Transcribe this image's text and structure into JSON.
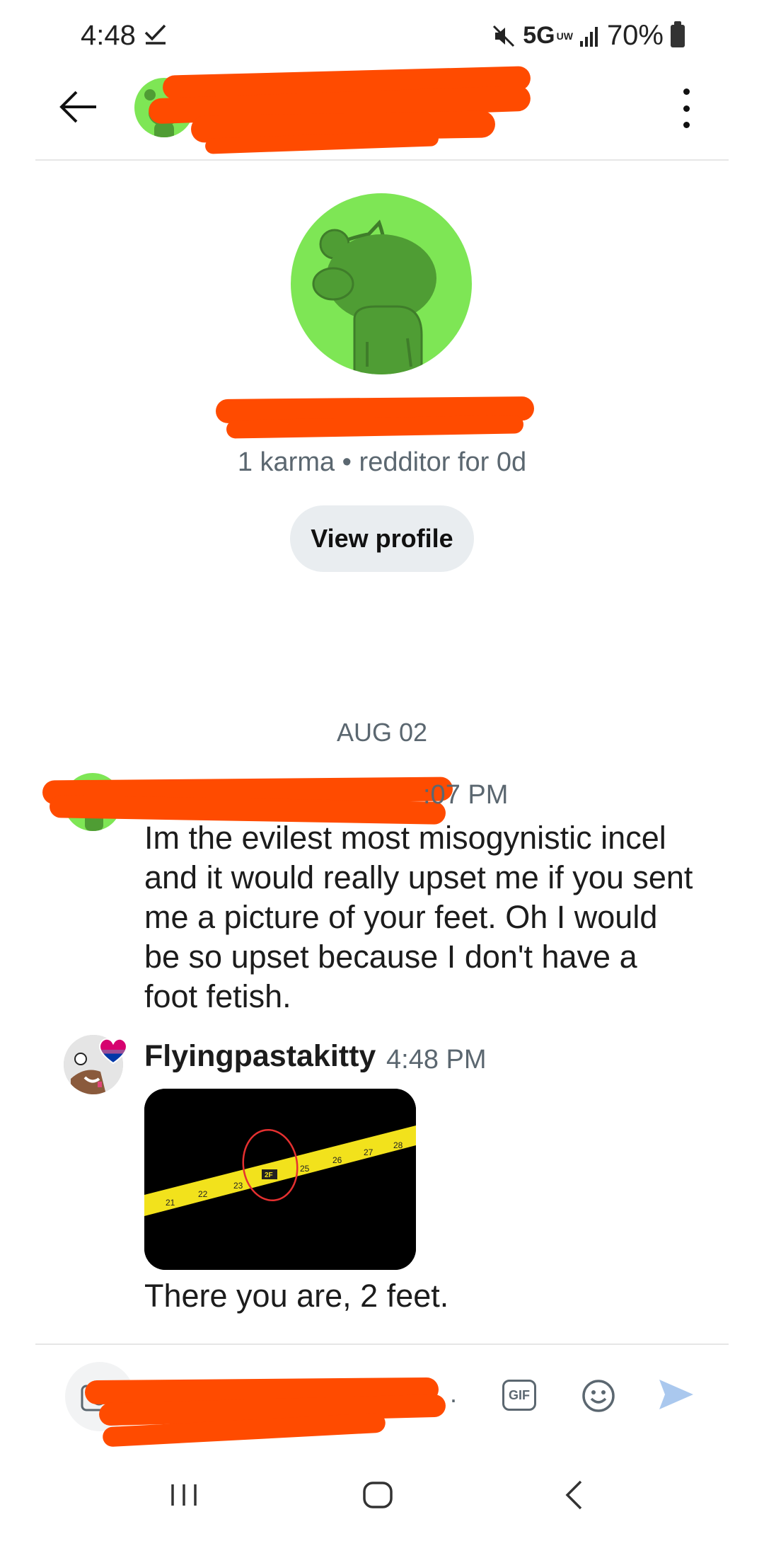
{
  "status_bar": {
    "time": "4:48",
    "network": "5G",
    "network_sub": "UW",
    "battery": "70%"
  },
  "header": {
    "name_visible": "2"
  },
  "profile": {
    "meta": "1 karma • redditor for 0d",
    "view_profile_label": "View profile"
  },
  "conversation": {
    "date_separator": "AUG 02",
    "messages": [
      {
        "time": ":07 PM",
        "text": "Im the evilest most misogynistic incel and it would really upset me if you sent me a picture of your feet. Oh I would be so upset because I don't have a foot fetish."
      },
      {
        "username": "Flyingpastakitty",
        "time": "4:48 PM",
        "text": "There you are, 2 feet.",
        "image": "tape-measure-photo"
      }
    ]
  },
  "composer": {
    "gif_label": "GIF",
    "trailing_char": "."
  },
  "icons": {
    "back": "arrow-left-icon",
    "overflow": "more-vertical-icon",
    "camera": "camera-icon",
    "emoji": "smiley-icon",
    "send": "send-icon",
    "mute": "mute-icon"
  },
  "colors": {
    "avatar_green": "#7ee655",
    "redaction": "#ff4b00",
    "button_bg": "#e9edf0",
    "meta_text": "#5b6770",
    "send_blue": "#aac8ee"
  }
}
